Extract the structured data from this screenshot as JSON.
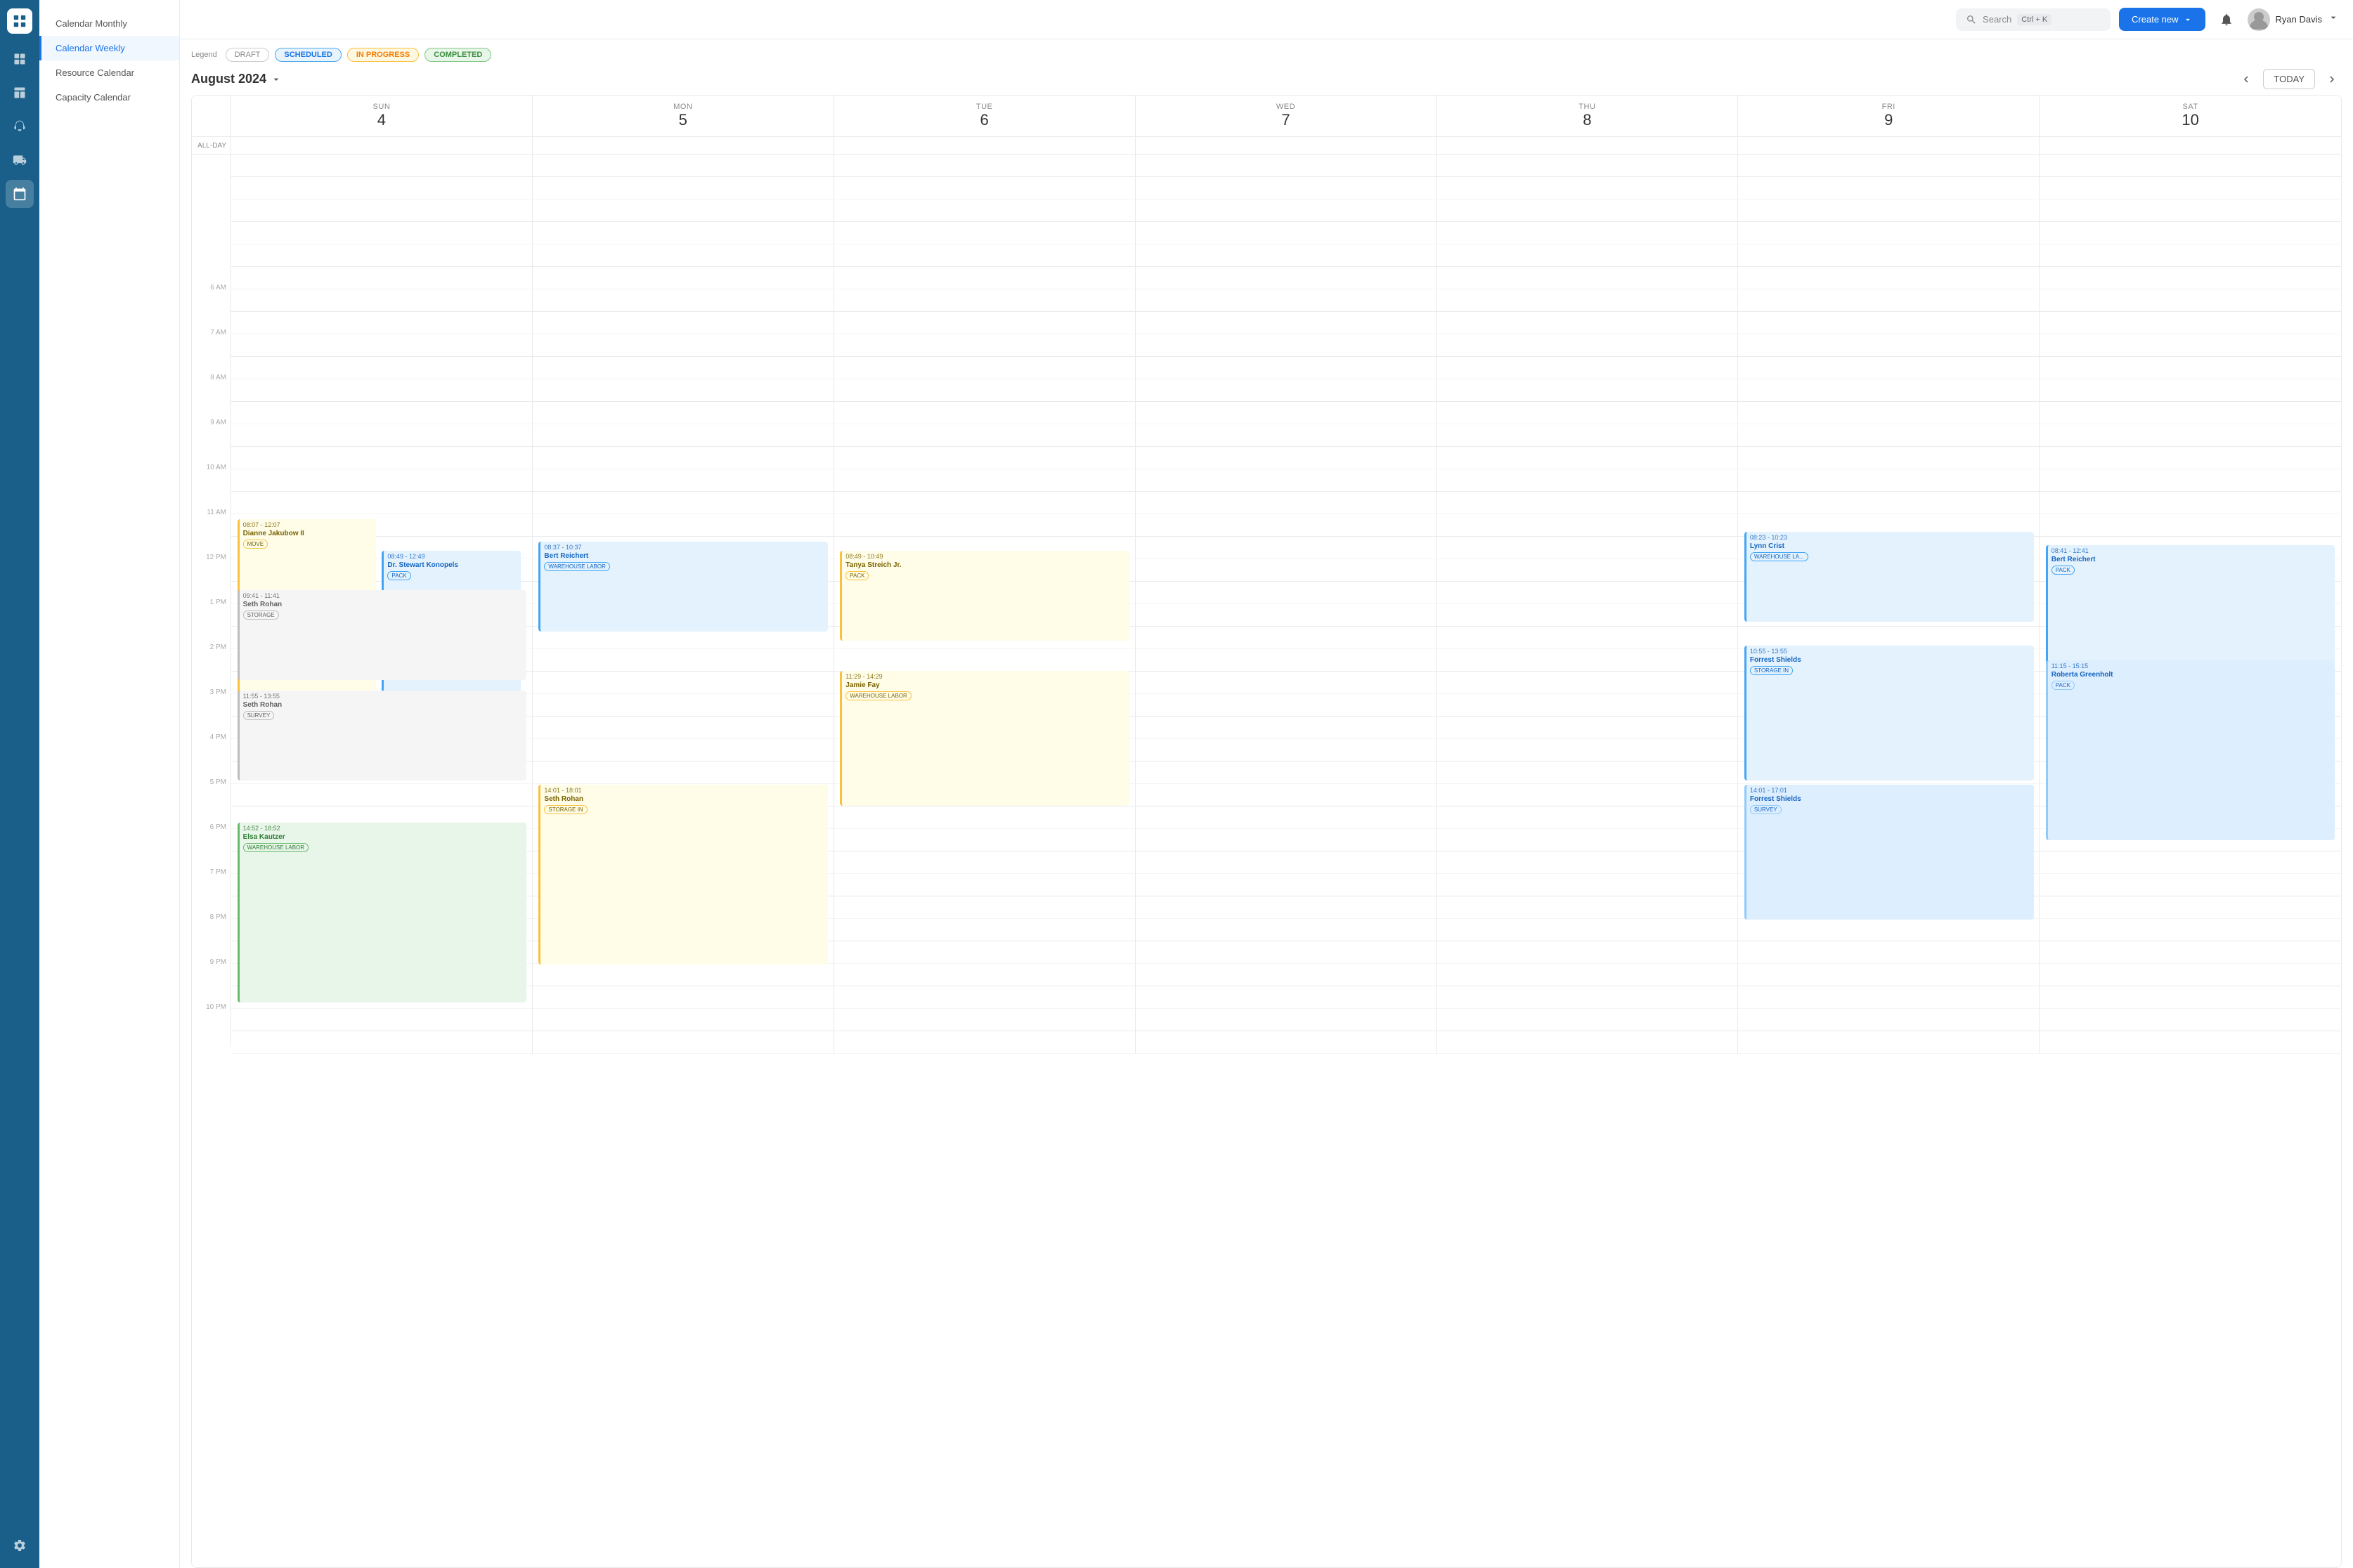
{
  "app": {
    "logo_alt": "App logo"
  },
  "topbar": {
    "search_placeholder": "Search",
    "search_shortcut": "Ctrl + K",
    "create_button_label": "Create new",
    "notification_icon": "bell-icon",
    "user_name": "Ryan Davis",
    "user_chevron": "chevron-down-icon"
  },
  "sidebar": {
    "icons": [
      {
        "name": "grid-icon",
        "label": "Dashboard"
      },
      {
        "name": "layout-icon",
        "label": "Layout"
      },
      {
        "name": "headset-icon",
        "label": "Support"
      },
      {
        "name": "truck-icon",
        "label": "Logistics"
      },
      {
        "name": "calendar-icon",
        "label": "Calendar",
        "active": true
      },
      {
        "name": "settings-icon",
        "label": "Settings"
      }
    ]
  },
  "left_nav": {
    "items": [
      {
        "label": "Calendar Monthly",
        "active": false
      },
      {
        "label": "Calendar Weekly",
        "active": true
      },
      {
        "label": "Resource Calendar",
        "active": false
      },
      {
        "label": "Capacity Calendar",
        "active": false
      }
    ]
  },
  "legend": {
    "label": "Legend",
    "badges": [
      {
        "label": "DRAFT",
        "type": "draft"
      },
      {
        "label": "SCHEDULED",
        "type": "scheduled"
      },
      {
        "label": "IN PROGRESS",
        "type": "in-progress"
      },
      {
        "label": "COMPLETED",
        "type": "completed"
      }
    ]
  },
  "calendar": {
    "month_year": "August  2024",
    "today_label": "TODAY",
    "days": [
      {
        "dow": "SUN",
        "dom": "4"
      },
      {
        "dow": "MON",
        "dom": "5"
      },
      {
        "dow": "TUE",
        "dom": "6"
      },
      {
        "dow": "WED",
        "dom": "7"
      },
      {
        "dow": "THU",
        "dom": "8"
      },
      {
        "dow": "FRI",
        "dom": "9"
      },
      {
        "dow": "SAT",
        "dom": "10"
      }
    ],
    "allday_label": "ALL-DAY",
    "hours": [
      "",
      "",
      "",
      "",
      "",
      "",
      "6 AM",
      "",
      "7 AM",
      "",
      "8 AM",
      "",
      "9 AM",
      "",
      "10 AM",
      "",
      "11 AM",
      "",
      "12 PM",
      "",
      "1 PM",
      "",
      "2 PM",
      "",
      "3 PM",
      "",
      "4 PM",
      "",
      "5 PM",
      "",
      "6 PM",
      "",
      "7 PM",
      "",
      "8 PM",
      "",
      "9 PM",
      "",
      "10 PM"
    ],
    "events": [
      {
        "id": "e1",
        "day": 0,
        "top_pct": 35.8,
        "height_pct": 19.5,
        "left_pct": 2,
        "width_pct": 46,
        "color": "yellow",
        "time": "08:07 - 12:07",
        "name": "Dianne Jakubow II",
        "badge": "MOVE"
      },
      {
        "id": "e2",
        "day": 0,
        "top_pct": 38.5,
        "height_pct": 14,
        "left_pct": 50,
        "width_pct": 46,
        "color": "blue",
        "time": "08:49 - 12:49",
        "name": "Dr. Stewart Konopels",
        "badge": "PACK"
      },
      {
        "id": "e3",
        "day": 0,
        "top_pct": 42.5,
        "height_pct": 8.5,
        "left_pct": 2,
        "width_pct": 96,
        "color": "gray",
        "time": "09:41 - 11:41",
        "name": "Seth Rohan",
        "badge": "STORAGE"
      },
      {
        "id": "e4",
        "day": 0,
        "top_pct": 51.5,
        "height_pct": 9.5,
        "left_pct": 2,
        "width_pct": 96,
        "color": "gray",
        "time": "11:55 - 13:55",
        "name": "Seth Rohan",
        "badge": "SURVEY"
      },
      {
        "id": "e5",
        "day": 0,
        "top_pct": 62,
        "height_pct": 19,
        "left_pct": 2,
        "width_pct": 96,
        "color": "green",
        "time": "14:52 - 18:52",
        "name": "Elsa Kautzer",
        "badge": "WAREHOUSE LABOR"
      },
      {
        "id": "e6",
        "day": 1,
        "top_pct": 34,
        "height_pct": 14.5,
        "left_pct": 2,
        "width_pct": 96,
        "color": "blue",
        "time": "08:37 - 10:37",
        "name": "Bert Reichert",
        "badge": "WAREHOUSE LABOR"
      },
      {
        "id": "e7",
        "day": 1,
        "top_pct": 52,
        "height_pct": 19,
        "left_pct": 2,
        "width_pct": 96,
        "color": "yellow",
        "time": "14:01 - 18:01",
        "name": "Seth Rohan",
        "badge": "STORAGE IN"
      },
      {
        "id": "e8",
        "day": 2,
        "top_pct": 38,
        "height_pct": 9,
        "left_pct": 2,
        "width_pct": 96,
        "color": "yellow",
        "time": "08:49 - 10:49",
        "name": "Tanya Streich Jr.",
        "badge": "PACK"
      },
      {
        "id": "e9",
        "day": 2,
        "top_pct": 48.5,
        "height_pct": 14,
        "left_pct": 2,
        "width_pct": 96,
        "color": "yellow",
        "time": "11:29 - 14:29",
        "name": "Jamie Fay",
        "badge": "WAREHOUSE LABOR"
      },
      {
        "id": "e10",
        "day": 5,
        "top_pct": 36,
        "height_pct": 10,
        "left_pct": 2,
        "width_pct": 96,
        "color": "blue",
        "time": "08:23 - 10:23",
        "name": "Lynn Crist",
        "badge": "WAREHOUSE LA..."
      },
      {
        "id": "e11",
        "day": 5,
        "top_pct": 47,
        "height_pct": 12,
        "left_pct": 2,
        "width_pct": 96,
        "color": "blue",
        "time": "10:55 - 13:55",
        "name": "Forrest Shields",
        "badge": "STORAGE IN"
      },
      {
        "id": "e12",
        "day": 5,
        "top_pct": 59,
        "height_pct": 14,
        "left_pct": 2,
        "width_pct": 96,
        "color": "blue-light",
        "time": "14:01 - 17:01",
        "name": "Forrest Shields",
        "badge": "SURVEY"
      },
      {
        "id": "e13",
        "day": 6,
        "top_pct": 36,
        "height_pct": 10,
        "left_pct": 2,
        "width_pct": 96,
        "color": "blue",
        "time": "08:41 - 12:41",
        "name": "Bert Reichert",
        "badge": "PACK"
      },
      {
        "id": "e14",
        "day": 6,
        "top_pct": 47.5,
        "height_pct": 18,
        "left_pct": 2,
        "width_pct": 96,
        "color": "blue-light",
        "time": "11:15 - 15:15",
        "name": "Roberta Greenholt",
        "badge": "PACK"
      }
    ]
  }
}
